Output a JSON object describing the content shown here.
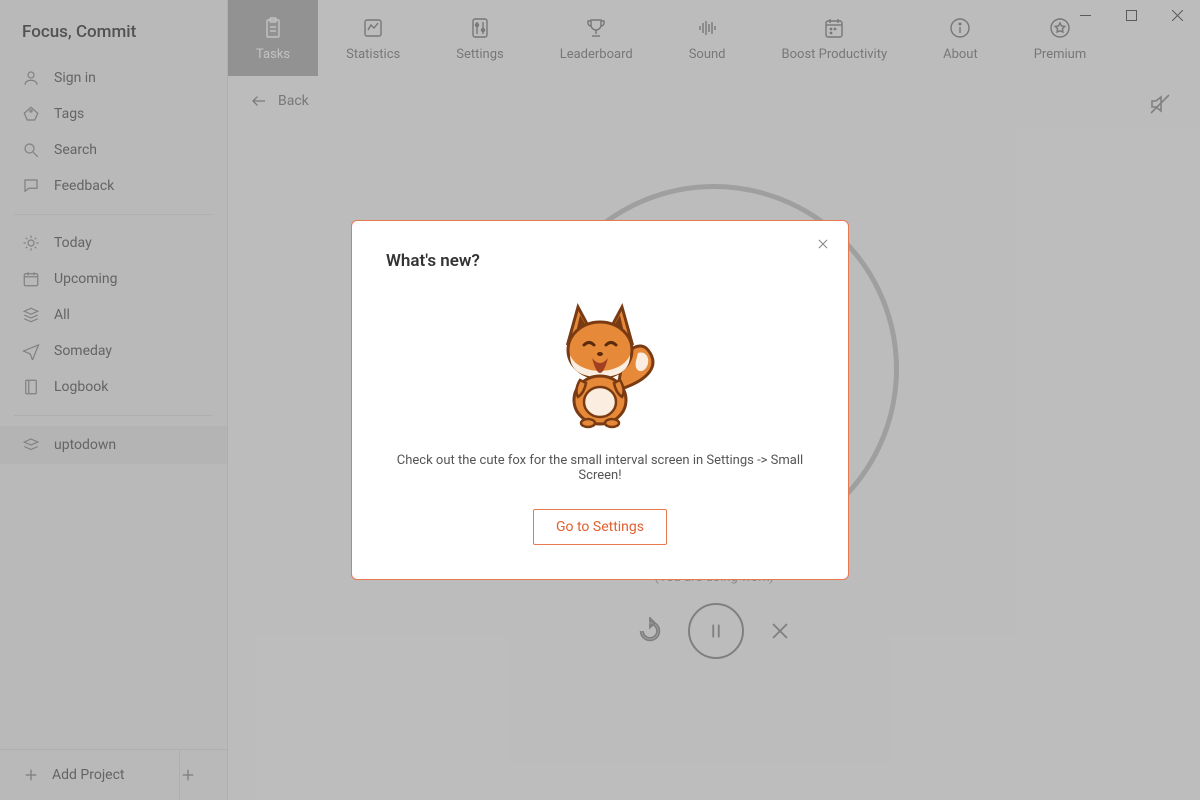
{
  "app_title": "Focus, Commit",
  "sidebar": {
    "nav": [
      {
        "id": "signin",
        "label": "Sign in",
        "icon": "user-icon"
      },
      {
        "id": "tags",
        "label": "Tags",
        "icon": "tag-icon"
      },
      {
        "id": "search",
        "label": "Search",
        "icon": "search-icon"
      },
      {
        "id": "feedback",
        "label": "Feedback",
        "icon": "chat-icon"
      }
    ],
    "views": [
      {
        "id": "today",
        "label": "Today",
        "icon": "sun-icon"
      },
      {
        "id": "upcoming",
        "label": "Upcoming",
        "icon": "calendar-icon"
      },
      {
        "id": "all",
        "label": "All",
        "icon": "stack-icon"
      },
      {
        "id": "someday",
        "label": "Someday",
        "icon": "plane-icon"
      },
      {
        "id": "logbook",
        "label": "Logbook",
        "icon": "book-icon"
      }
    ],
    "projects": [
      {
        "id": "uptodown",
        "label": "uptodown"
      }
    ],
    "add_project_label": "Add Project"
  },
  "toolbar": {
    "items": [
      {
        "id": "tasks",
        "label": "Tasks",
        "icon": "clipboard-icon",
        "active": true
      },
      {
        "id": "statistics",
        "label": "Statistics",
        "icon": "chart-icon",
        "active": false
      },
      {
        "id": "settings",
        "label": "Settings",
        "icon": "sliders-icon",
        "active": false
      },
      {
        "id": "leaderboard",
        "label": "Leaderboard",
        "icon": "trophy-icon",
        "active": false
      },
      {
        "id": "sound",
        "label": "Sound",
        "icon": "sound-icon",
        "active": false
      },
      {
        "id": "boost",
        "label": "Boost Productivity",
        "icon": "calendar2-icon",
        "active": false
      },
      {
        "id": "about",
        "label": "About",
        "icon": "info-icon",
        "active": false
      },
      {
        "id": "premium",
        "label": "Premium",
        "icon": "star-icon",
        "active": false
      }
    ]
  },
  "back_label": "Back",
  "timer": {
    "status_text": "(You are doing work)"
  },
  "modal": {
    "title": "What's new?",
    "body": "Check out the cute fox for the small interval screen in Settings -> Small Screen!",
    "action_label": "Go to Settings"
  }
}
